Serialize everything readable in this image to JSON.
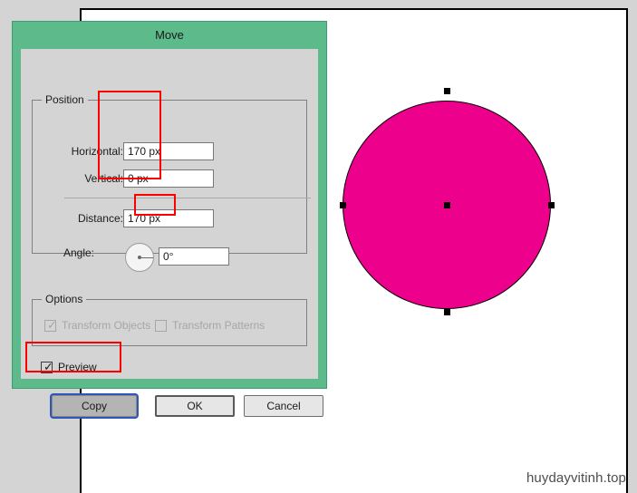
{
  "app": {
    "canvas_background": "#d4d4d4",
    "artboard_background": "#ffffff"
  },
  "shape": {
    "name": "magenta-circle",
    "fill_color": "#ec008c",
    "stroke_color": "#000000",
    "anchor_points": [
      "top",
      "right",
      "bottom",
      "left",
      "center"
    ]
  },
  "watermark": {
    "text": "huydayvitinh.top"
  },
  "dialog": {
    "title": "Move",
    "titlebar_color": "#5cba8b",
    "position_group": {
      "legend": "Position",
      "fields": [
        {
          "label": "Horizontal:",
          "value": "170 px"
        },
        {
          "label": "Vertical:",
          "value": "0 px"
        },
        {
          "label": "Distance:",
          "value": "170 px"
        },
        {
          "label": "Angle:",
          "value": "0°"
        }
      ]
    },
    "options_group": {
      "legend": "Options",
      "checkboxes": [
        {
          "label": "Transform Objects",
          "checked": true,
          "disabled": true
        },
        {
          "label": "Transform Patterns",
          "checked": false,
          "disabled": true
        }
      ]
    },
    "preview": {
      "label": "Preview",
      "checked": true
    },
    "buttons": {
      "copy": "Copy",
      "ok": "OK",
      "cancel": "Cancel"
    }
  },
  "annotations": {
    "color": "#ff0000",
    "boxes": [
      "position-fields",
      "angle-field",
      "copy-button"
    ]
  }
}
